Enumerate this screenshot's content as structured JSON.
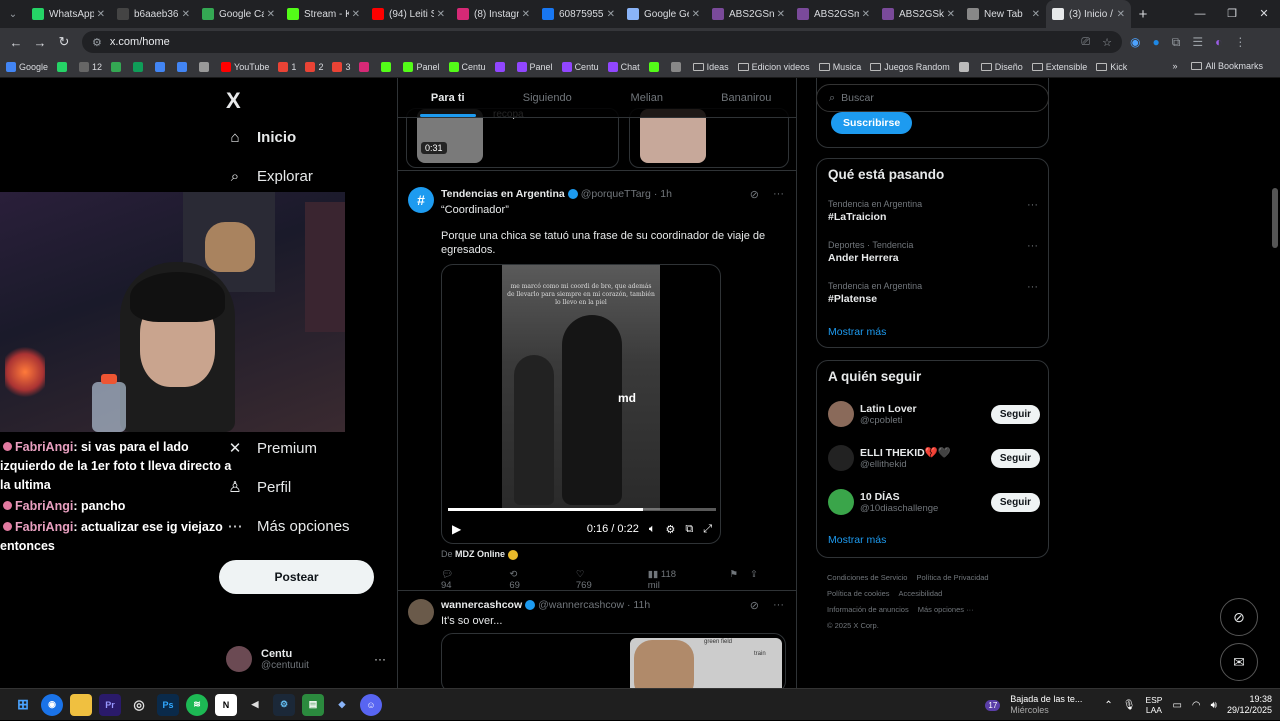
{
  "browser": {
    "tabs": [
      {
        "label": "WhatsApp",
        "color": "#25d366"
      },
      {
        "label": "b6aaeb36",
        "color": "#444"
      },
      {
        "label": "Google Ca",
        "color": "#34a853"
      },
      {
        "label": "Stream - K",
        "color": "#53fc18"
      },
      {
        "label": "(94) Leiti S",
        "color": "#ff0000"
      },
      {
        "label": "(8) Instagr",
        "color": "#d62976"
      },
      {
        "label": "60875955",
        "color": "#1877f2"
      },
      {
        "label": "Google Ge",
        "color": "#8ab4f8"
      },
      {
        "label": "ABS2GSn",
        "color": "#7a4a9a"
      },
      {
        "label": "ABS2GSm",
        "color": "#7a4a9a"
      },
      {
        "label": "ABS2GSk",
        "color": "#7a4a9a"
      },
      {
        "label": "New Tab",
        "color": "#888"
      },
      {
        "label": "(3) Inicio /",
        "color": "#e7e9ea",
        "active": true
      }
    ],
    "url": "x.com/home",
    "bookmarks": [
      {
        "label": "Google",
        "color": "#4285f4"
      },
      {
        "label": "",
        "color": "#25d366"
      },
      {
        "label": "12",
        "color": "#666"
      },
      {
        "label": "",
        "color": "#34a853"
      },
      {
        "label": "",
        "color": "#0f9d58"
      },
      {
        "label": "",
        "color": "#4285f4"
      },
      {
        "label": "",
        "color": "#4285f4"
      },
      {
        "label": "",
        "color": "#999"
      },
      {
        "label": "YouTube",
        "color": "#ff0000"
      },
      {
        "label": "1",
        "color": "#ea4335"
      },
      {
        "label": "2",
        "color": "#ea4335"
      },
      {
        "label": "3",
        "color": "#ea4335"
      },
      {
        "label": "",
        "color": "#d62976"
      },
      {
        "label": "",
        "color": "#53fc18"
      },
      {
        "label": "Panel",
        "color": "#53fc18"
      },
      {
        "label": "Centu",
        "color": "#53fc18"
      },
      {
        "label": "",
        "color": "#9146ff"
      },
      {
        "label": "Panel",
        "color": "#9146ff"
      },
      {
        "label": "Centu",
        "color": "#9146ff"
      },
      {
        "label": "Chat",
        "color": "#9146ff"
      },
      {
        "label": "",
        "color": "#53fc18"
      },
      {
        "label": "",
        "color": "#888"
      },
      {
        "label": "Ideas",
        "folder": true
      },
      {
        "label": "Edicion videos",
        "folder": true
      },
      {
        "label": "Musica",
        "folder": true
      },
      {
        "label": "Juegos Random",
        "folder": true
      },
      {
        "label": "",
        "color": "#bbb"
      },
      {
        "label": "Diseño",
        "folder": true
      },
      {
        "label": "Extensible",
        "folder": true
      },
      {
        "label": "Kick",
        "folder": true
      }
    ],
    "all_bookmarks": "All Bookmarks"
  },
  "nav": {
    "logo": "X",
    "inicio": "Inicio",
    "explorar": "Explorar",
    "premium": "Premium",
    "perfil": "Perfil",
    "mas": "Más opciones",
    "post": "Postear",
    "account_name": "Centu",
    "account_handle": "@centutuit"
  },
  "chat": [
    {
      "user": "FabriAngi",
      "msg": ": si vas para el lado izquierdo de la 1er foto t lleva directo a la ultima"
    },
    {
      "user": "FabriAngi",
      "msg": ": pancho"
    },
    {
      "user": "FabriAngi",
      "msg": ": actualizar ese ig viejazo entonces"
    }
  ],
  "feed": {
    "tabs": [
      "Para ti",
      "Siguiendo",
      "Melian",
      "Bananirou"
    ],
    "prev_caption": "recopa",
    "prev_duration": "0:31",
    "tweet1": {
      "name": "Tendencias en Argentina",
      "handle": "@porqueTTarg",
      "time": "1h",
      "title": "“Coordinador”",
      "text": "Porque una chica se tatuó una frase de su coordinador de viaje de egresados.",
      "video_overlay": "me marcó como mi coordi de bre, que además de llevarlo para siempre en mi corazón, también lo llevo en la piel",
      "video_logo": "md",
      "video_time": "0:16 / 0:22",
      "video_progress": 0.727,
      "source_prefix": "De",
      "source": "MDZ Online",
      "replies": "94",
      "reposts": "69",
      "likes": "769",
      "views": "118 mil"
    },
    "tweet2": {
      "name": "wannercashcow",
      "handle": "@wannercashcow",
      "time": "11h",
      "text": "It's so over...",
      "media_labels": [
        "green field",
        "train"
      ]
    }
  },
  "right": {
    "search_placeholder": "Buscar",
    "subscribe": "Suscribirse",
    "trending_title": "Qué está pasando",
    "trends": [
      {
        "cat": "Tendencia en Argentina",
        "name": "#LaTraicion"
      },
      {
        "cat": "Deportes · Tendencia",
        "name": "Ander Herrera"
      },
      {
        "cat": "Tendencia en Argentina",
        "name": "#Platense"
      }
    ],
    "show_more": "Mostrar más",
    "follow_title": "A quién seguir",
    "follows": [
      {
        "name": "Latin Lover",
        "handle": "@cpobleti",
        "btn": "Seguir",
        "color": "#8a6a5a"
      },
      {
        "name": "ELLI THEKID💔🖤",
        "handle": "@ellithekid",
        "btn": "Seguir",
        "color": "#222"
      },
      {
        "name": "10 DÍAS",
        "handle": "@10diaschallenge",
        "btn": "Seguir",
        "color": "#3aa54a"
      }
    ],
    "footer": [
      "Condiciones de Servicio",
      "Política de Privacidad",
      "Política de cookies",
      "Accesibilidad",
      "Información de anuncios",
      "Más opciones ···",
      "© 2025 X Corp."
    ]
  },
  "taskbar": {
    "weather_title": "Bajada de las te...",
    "weather_sub": "Miércoles",
    "lang1": "ESP",
    "lang2": "LAA",
    "time": "19:38",
    "date": "29/12/2025",
    "weather_badge": "17"
  }
}
